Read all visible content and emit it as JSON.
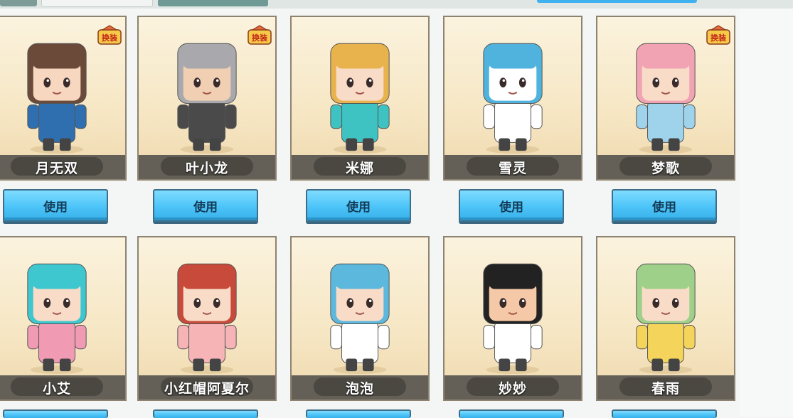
{
  "use_label": "使用",
  "badge_label": "换装",
  "rows": [
    {
      "skins": [
        {
          "name": "月无双",
          "badge": true,
          "hair": "#6b4a3a",
          "accent": "#2f6fb0",
          "skin": "#f7d7bf"
        },
        {
          "name": "叶小龙",
          "badge": true,
          "hair": "#a9a9ad",
          "accent": "#4a4a4a",
          "skin": "#f1cfb3"
        },
        {
          "name": "米娜",
          "badge": false,
          "hair": "#e8b24c",
          "accent": "#3ec2c2",
          "skin": "#f9dcc7"
        },
        {
          "name": "雪灵",
          "badge": false,
          "hair": "#4fb3dd",
          "accent": "#ffffff",
          "skin": "#ffffff"
        },
        {
          "name": "梦歌",
          "badge": true,
          "hair": "#f2a3b3",
          "accent": "#9fd3ec",
          "skin": "#f9dcc7"
        }
      ]
    },
    {
      "skins": [
        {
          "name": "小艾",
          "badge": false,
          "hair": "#3fc7cf",
          "accent": "#f19ab4",
          "skin": "#f9dcc7"
        },
        {
          "name": "小红帽阿夏尔",
          "badge": false,
          "hair": "#c84a3b",
          "accent": "#f6b4b6",
          "skin": "#f9dcc7"
        },
        {
          "name": "泡泡",
          "badge": false,
          "hair": "#5cb8dd",
          "accent": "#ffffff",
          "skin": "#f9dcc7"
        },
        {
          "name": "妙妙",
          "badge": false,
          "hair": "#222222",
          "accent": "#ffffff",
          "skin": "#f5c9a7"
        },
        {
          "name": "春雨",
          "badge": false,
          "hair": "#9fd08a",
          "accent": "#f4d45a",
          "skin": "#f9dcc7"
        }
      ]
    }
  ]
}
